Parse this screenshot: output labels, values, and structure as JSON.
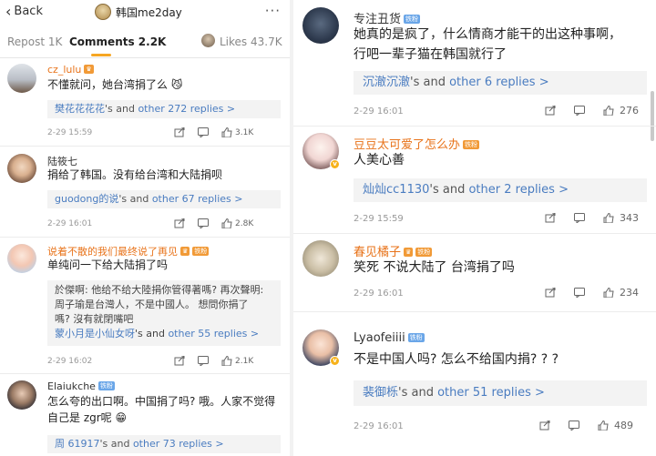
{
  "header": {
    "back_label": "Back",
    "title": "韩国me2day",
    "more": "···"
  },
  "tabs": {
    "repost": "Repost 1K",
    "comments": "Comments 2.2K",
    "likes": "Likes 43.7K"
  },
  "left_comments": [
    {
      "name": "cz_lulu",
      "text": "不懂就问，她台湾捐了么",
      "emoji": "😼",
      "reply_user": "樊花花花花",
      "reply_rest": "'s and",
      "reply_more": "other 272 replies >",
      "time": "2-29 15:59",
      "likes": "3.1K"
    },
    {
      "name": "陆筱七",
      "text_lines": [
        "捐给了韩国。没有给台湾和大陆捐呗"
      ],
      "reply_user": "guodong的说",
      "reply_rest": "'s and",
      "reply_more": "other 67 replies >",
      "time": "2-29 16:01",
      "likes": "2.8K"
    },
    {
      "name": "说着不散的我们最终说了再见",
      "badge": "铁粉",
      "text_lines": [
        "单纯问一下给大陆捐了吗"
      ],
      "quote_user": "於傑啊",
      "quote_lines": [
        "於傑啊: 他给不给大陸捐你管得著嗎? 再次聲明:",
        "周子瑜是台灣人，不是中國人。  想問你捐了",
        "嗎? 沒有就閉嘴吧"
      ],
      "reply_user": "蒙小月是小仙女呀",
      "reply_rest": "'s and",
      "reply_more": "other 55 replies >",
      "time": "2-29 16:02",
      "likes": "2.1K"
    },
    {
      "name": "Elaiukche",
      "badge": "铁粉",
      "text_lines": [
        "怎么夸的出口啊。中国捐了吗? 哦。人家不觉得",
        "自己是 zgr呢"
      ],
      "emoji": "😁",
      "reply_user": "周 61917",
      "reply_rest": "'s and",
      "reply_more": "other 73 replies >"
    }
  ],
  "right_comments": [
    {
      "name": "专注丑货",
      "badge": "铁粉",
      "text_lines": [
        "她真的是疯了，什么情商才能干的出这种事啊，",
        "行吧一辈子猫在韩国就行了"
      ],
      "reply_user": "沉澈沉澈",
      "reply_rest": "'s and",
      "reply_more": "other 6 replies >",
      "time": "2-29 16:01",
      "likes": "276"
    },
    {
      "name": "豆豆太可爱了怎么办",
      "badge": "铁粉",
      "text_lines": [
        "人美心善"
      ],
      "reply_user": "灿灿cc1130",
      "reply_rest": "'s and",
      "reply_more": "other 2 replies >",
      "time": "2-29 15:59",
      "likes": "343"
    },
    {
      "name": "春见橘子",
      "badge": "铁粉",
      "text_lines": [
        "笑死 不说大陆了 台湾捐了吗"
      ],
      "time": "2-29 16:01",
      "likes": "234"
    },
    {
      "name": "Lyaofeiiii",
      "badge": "铁粉",
      "text_lines": [
        "不是中国人吗? 怎么不给国内捐? ? ?"
      ],
      "reply_user": "裴御栎",
      "reply_rest": "'s and",
      "reply_more": "other 51 replies >",
      "time": "2-29 16:01",
      "likes": "489"
    }
  ],
  "colors": {
    "accent": "#f6a623",
    "link": "#4a7cc0",
    "vip_name": "#e8731a",
    "background": "#f2f2f2"
  }
}
